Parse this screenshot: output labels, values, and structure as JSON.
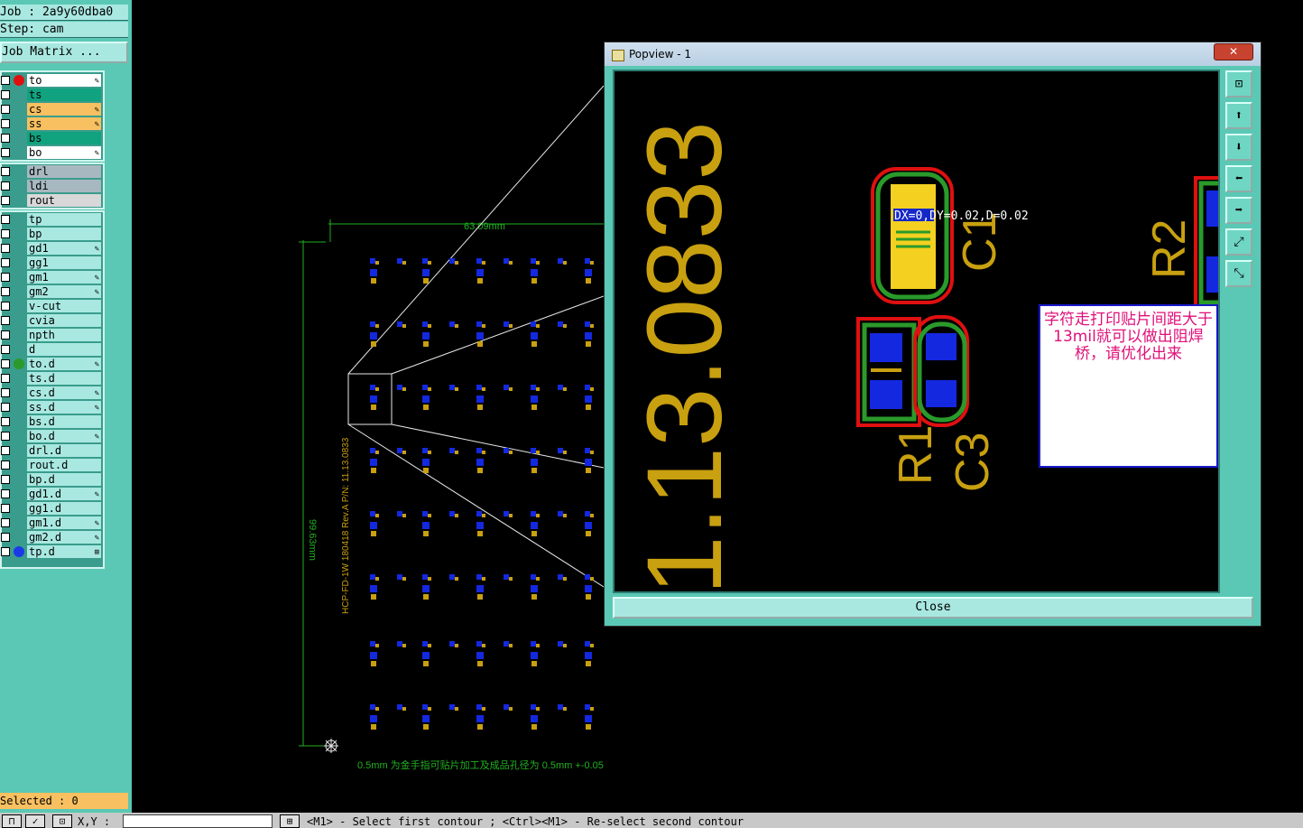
{
  "job": {
    "label": "Job : 2a9y60dba0",
    "step": "Step: cam"
  },
  "job_matrix_label": "Job Matrix ...",
  "layers": [
    {
      "name": "to",
      "color": "#ffffff",
      "dot": "#e01010",
      "edit": "✎"
    },
    {
      "name": "ts",
      "color": "#11a27f",
      "dot": "",
      "edit": ""
    },
    {
      "name": "cs",
      "color": "#f8c060",
      "dot": "",
      "edit": "✎"
    },
    {
      "name": "ss",
      "color": "#f8c060",
      "dot": "",
      "edit": "✎"
    },
    {
      "name": "bs",
      "color": "#11a27f",
      "dot": "",
      "edit": ""
    },
    {
      "name": "bo",
      "color": "#ffffff",
      "dot": "",
      "edit": "✎"
    },
    {
      "name": "drl",
      "color": "#a8b8c0",
      "dot": "",
      "edit": ""
    },
    {
      "name": "ldi",
      "color": "#a8b8c0",
      "dot": "",
      "edit": ""
    },
    {
      "name": "rout",
      "color": "#d8d8d8",
      "dot": "",
      "edit": ""
    },
    {
      "name": "tp",
      "color": "#a8e8e0",
      "dot": "",
      "edit": ""
    },
    {
      "name": "bp",
      "color": "#a8e8e0",
      "dot": "",
      "edit": ""
    },
    {
      "name": "gd1",
      "color": "#a8e8e0",
      "dot": "",
      "edit": "✎"
    },
    {
      "name": "gg1",
      "color": "#a8e8e0",
      "dot": "",
      "edit": ""
    },
    {
      "name": "gm1",
      "color": "#a8e8e0",
      "dot": "",
      "edit": "✎"
    },
    {
      "name": "gm2",
      "color": "#a8e8e0",
      "dot": "",
      "edit": "✎"
    },
    {
      "name": "v-cut",
      "color": "#a8e8e0",
      "dot": "",
      "edit": ""
    },
    {
      "name": "cvia",
      "color": "#a8e8e0",
      "dot": "",
      "edit": ""
    },
    {
      "name": "npth",
      "color": "#a8e8e0",
      "dot": "",
      "edit": ""
    },
    {
      "name": "d",
      "color": "#a8e8e0",
      "dot": "",
      "edit": ""
    },
    {
      "name": "to.d",
      "color": "#a8e8e0",
      "dot": "#2a9a2a",
      "edit": "✎"
    },
    {
      "name": "ts.d",
      "color": "#a8e8e0",
      "dot": "",
      "edit": ""
    },
    {
      "name": "cs.d",
      "color": "#a8e8e0",
      "dot": "",
      "edit": "✎"
    },
    {
      "name": "ss.d",
      "color": "#a8e8e0",
      "dot": "",
      "edit": "✎"
    },
    {
      "name": "bs.d",
      "color": "#a8e8e0",
      "dot": "",
      "edit": ""
    },
    {
      "name": "bo.d",
      "color": "#a8e8e0",
      "dot": "",
      "edit": "✎"
    },
    {
      "name": "drl.d",
      "color": "#a8e8e0",
      "dot": "",
      "edit": ""
    },
    {
      "name": "rout.d",
      "color": "#a8e8e0",
      "dot": "",
      "edit": ""
    },
    {
      "name": "bp.d",
      "color": "#a8e8e0",
      "dot": "",
      "edit": ""
    },
    {
      "name": "gd1.d",
      "color": "#a8e8e0",
      "dot": "",
      "edit": "✎"
    },
    {
      "name": "gg1.d",
      "color": "#a8e8e0",
      "dot": "",
      "edit": ""
    },
    {
      "name": "gm1.d",
      "color": "#a8e8e0",
      "dot": "",
      "edit": "✎"
    },
    {
      "name": "gm2.d",
      "color": "#a8e8e0",
      "dot": "",
      "edit": "✎"
    },
    {
      "name": "tp.d",
      "color": "#a8e8e0",
      "dot": "#1a3ae8",
      "edit": "⊞"
    }
  ],
  "selected_label": "Selected : 0",
  "board": {
    "width_dim": "63.09mm",
    "height_dim": "99.63mm",
    "vertical_text": "HCP-FD-1W 180418 Rev.A P/N: 11.13.0833",
    "bottom_note": "0.5mm 为金手指可贴片加工及成品孔径为 0.5mm +-0.05mm"
  },
  "popview": {
    "title": "Popview - 1",
    "close_x": "✕",
    "close_label": "Close",
    "big_text": "1.13.0833",
    "label_c1": "C1",
    "label_r1": "R1",
    "label_c3": "C3",
    "label_r2": "R2",
    "measure": "DX=0,DY=0.02,D=0.02",
    "note": "字符走打印贴片间距大于13mil就可以做出阻焊桥，请优化出来",
    "tools": [
      "zoom-fit-icon",
      "pan-up-icon",
      "pan-down-icon",
      "pan-left-icon",
      "pan-right-icon",
      "zoom-in-icon",
      "zoom-out-icon"
    ]
  },
  "status": {
    "xy_label": "X,Y :",
    "xy_value": "",
    "prompt": "<M1> - Select first contour ; <Ctrl><M1> - Re-select second contour"
  }
}
